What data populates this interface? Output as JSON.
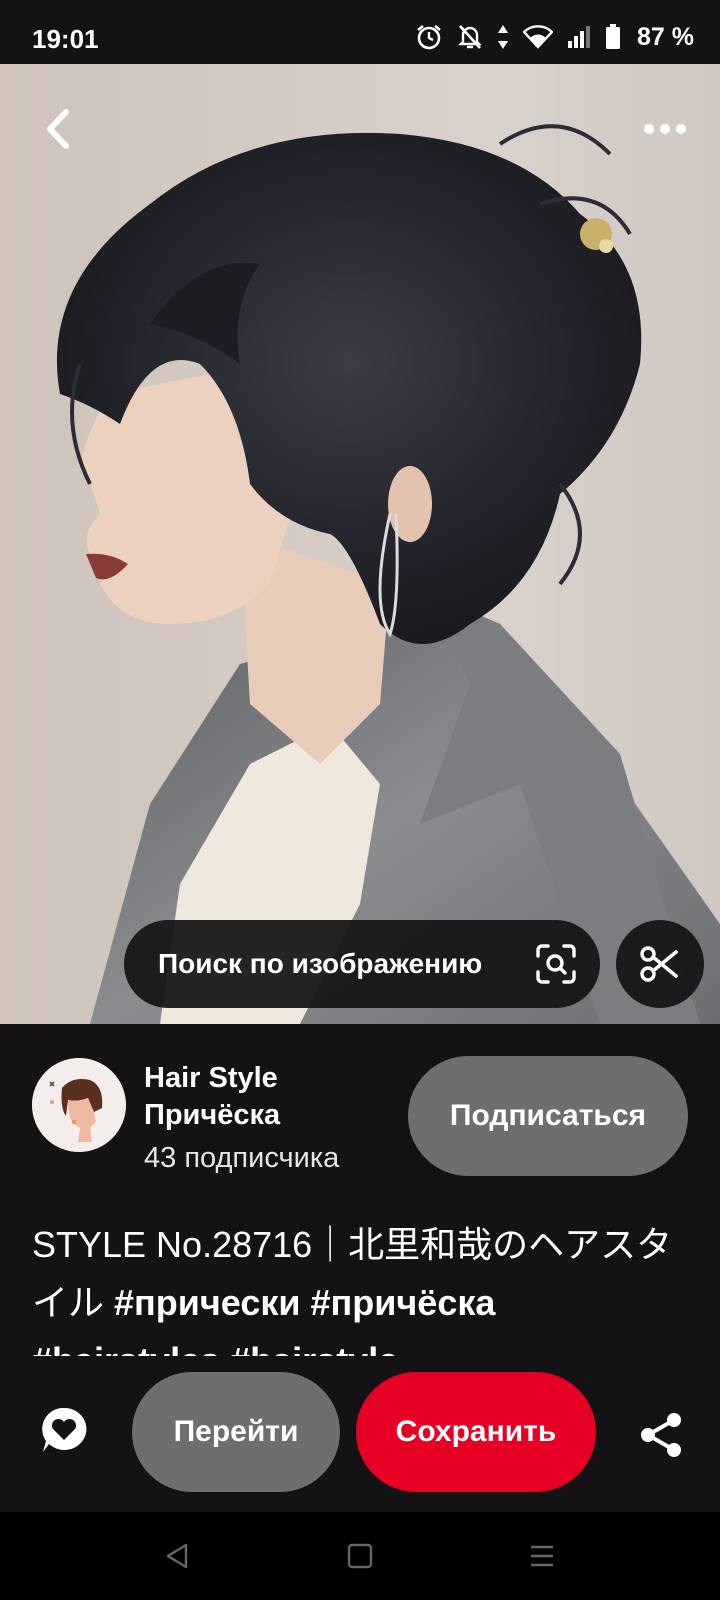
{
  "status_bar": {
    "time": "19:01",
    "battery": "87 %",
    "icons": [
      "alarm-icon",
      "notifications-off-icon",
      "data-arrows-icon",
      "wifi-icon",
      "signal-icon",
      "battery-icon"
    ]
  },
  "image": {
    "back_icon": "chevron-left-icon",
    "more_icon": "more-horizontal-icon",
    "visual_search_label": "Поиск по изображению",
    "visual_search_icon": "lens-search-icon",
    "crop_icon": "scissors-icon"
  },
  "creator": {
    "name": "Hair Style Причёска",
    "followers": "43 подписчика",
    "follow_label": "Подписаться"
  },
  "pin": {
    "title_plain": "STYLE No.28716｜北里和哉のヘアスタイル ",
    "title_tags": "#прически #причёска #hairstyles #hairstyle"
  },
  "actions": {
    "comment_icon": "comment-heart-icon",
    "visit_label": "Перейти",
    "save_label": "Сохранить",
    "share_icon": "share-icon"
  },
  "colors": {
    "background": "#141214",
    "save": "#e60023",
    "secondary_button": "#6f6d6e"
  }
}
